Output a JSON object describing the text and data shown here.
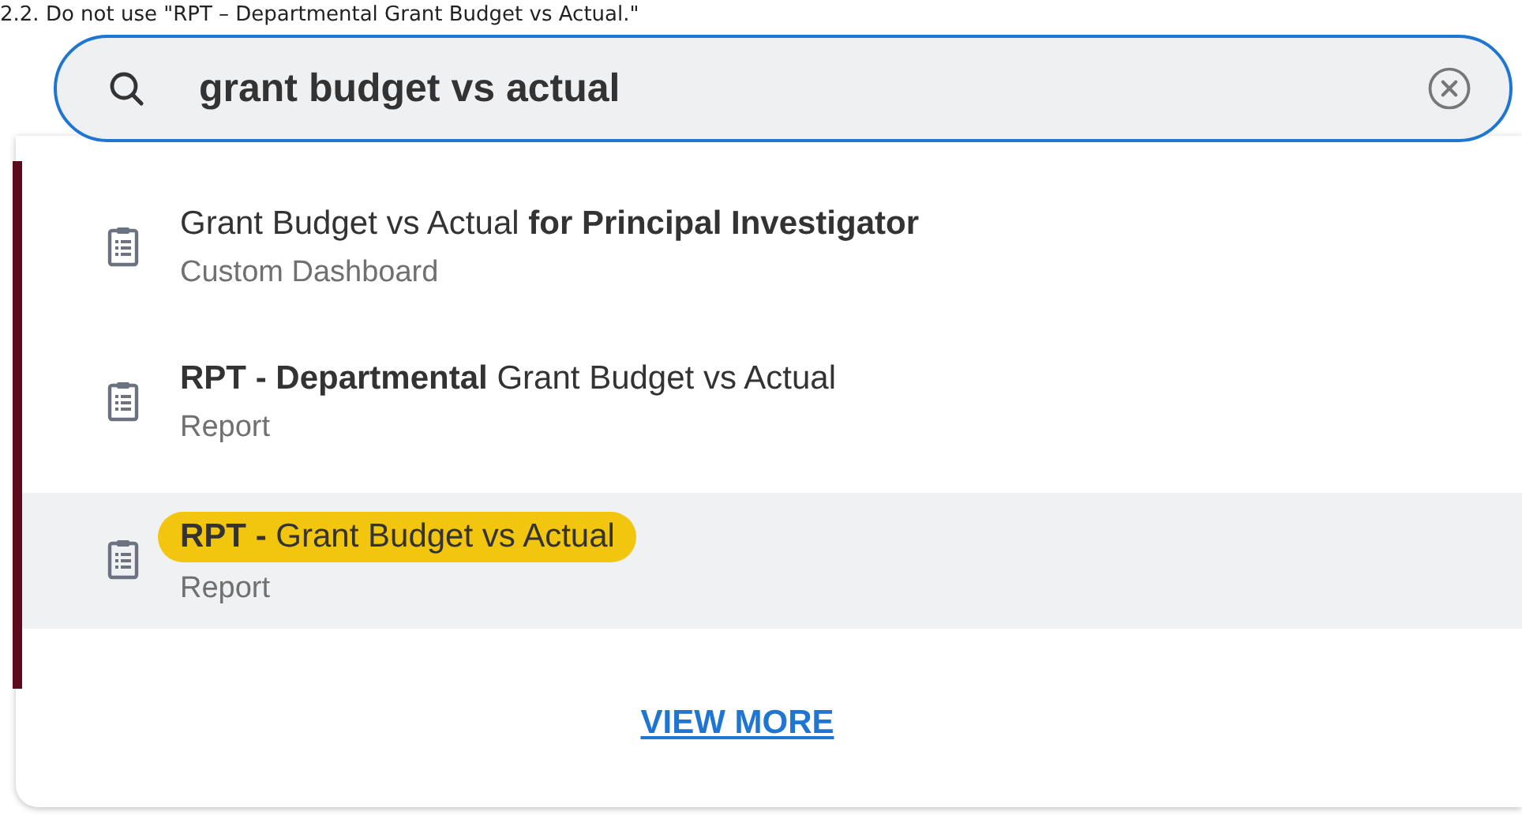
{
  "instruction": "2.2. Do not use \"RPT – Departmental Grant Budget vs Actual.\"",
  "search": {
    "value": "grant budget vs actual"
  },
  "results": [
    {
      "title": "Grant Budget vs Actual **for Principal Investigator**",
      "subtitle": "Custom Dashboard",
      "selected": false
    },
    {
      "title": "**RPT - Departmental** Grant Budget vs Actual",
      "subtitle": "Report",
      "selected": false
    },
    {
      "title": "**RPT -** Grant Budget vs Actual",
      "subtitle": "Report",
      "selected": true
    }
  ],
  "view_more": "VIEW MORE"
}
